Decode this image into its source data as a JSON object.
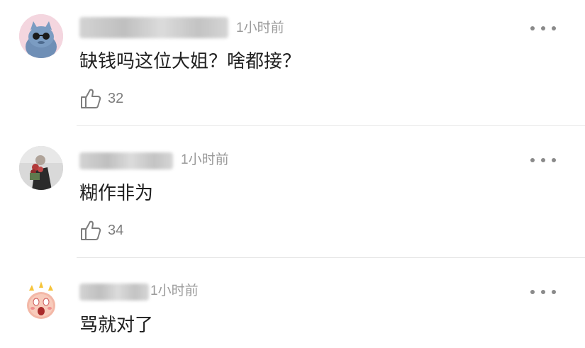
{
  "comments": [
    {
      "time": "1小时前",
      "text": "缺钱吗这位大姐？啥都接？",
      "likes": "32",
      "avatar_icon": "cartoon-cat-avatar"
    },
    {
      "time": "1小时前",
      "text": "糊作非为",
      "likes": "34",
      "avatar_icon": "photo-avatar-flowers"
    },
    {
      "time": "1小时前",
      "text": "骂就对了",
      "likes": "",
      "avatar_icon": "shocked-emoji-avatar"
    }
  ],
  "icons": {
    "more": "more-options-icon",
    "like": "thumbs-up-icon"
  },
  "colors": {
    "time_gray": "#9a9a9a",
    "text_dark": "#1f1f1f",
    "divider": "#e6e6e6"
  }
}
